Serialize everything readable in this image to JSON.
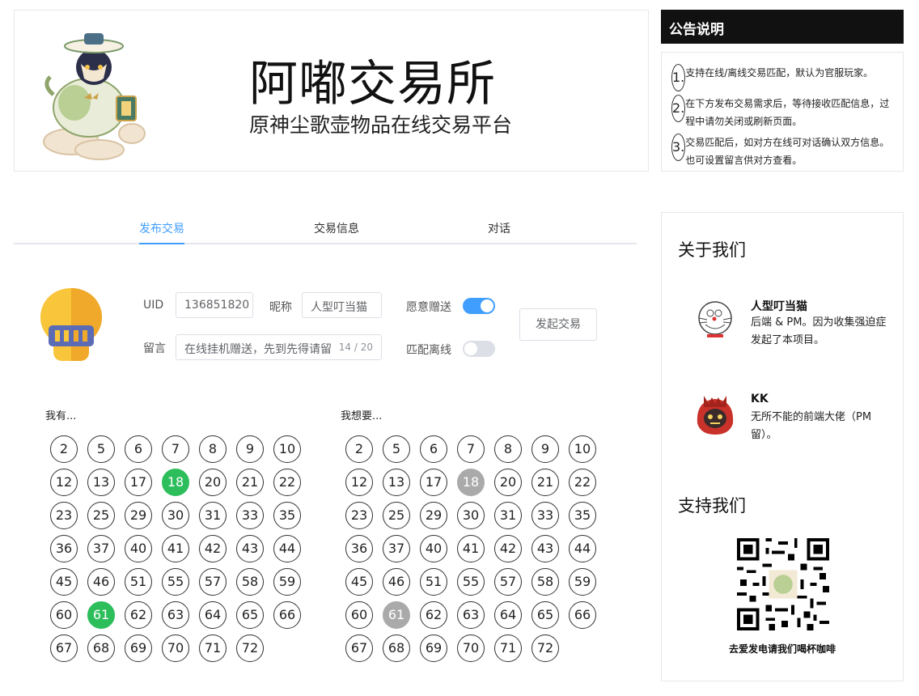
{
  "header": {
    "title": "阿嘟交易所",
    "subtitle": "原神尘歌壶物品在线交易平台"
  },
  "notice": {
    "title": "公告说明",
    "items": [
      {
        "num": "1.",
        "text": "支持在线/离线交易匹配，默认为官服玩家。"
      },
      {
        "num": "2.",
        "text": "在下方发布交易需求后，等待接收匹配信息，过程中请勿关闭或刷新页面。"
      },
      {
        "num": "3.",
        "text": "交易匹配后，如对方在线可对话确认双方信息。也可设置留言供对方查看。"
      }
    ]
  },
  "tabs": [
    {
      "label": "发布交易",
      "active": true
    },
    {
      "label": "交易信息",
      "active": false
    },
    {
      "label": "对话",
      "active": false
    }
  ],
  "form": {
    "uid_label": "UID",
    "uid_value": "136851820",
    "nickname_label": "昵称",
    "nickname_value": "人型叮当猫",
    "message_label": "留言",
    "message_value": "在线挂机赠送，先到先得请留",
    "message_counter": "14 / 20",
    "gift_label": "愿意赠送",
    "gift_on": true,
    "offline_label": "匹配离线",
    "offline_on": false,
    "submit_label": "发起交易"
  },
  "have": {
    "title": "我有...",
    "numbers": [
      "2",
      "5",
      "6",
      "7",
      "8",
      "9",
      "10",
      "12",
      "13",
      "17",
      "18",
      "20",
      "21",
      "22",
      "23",
      "25",
      "29",
      "30",
      "31",
      "33",
      "35",
      "36",
      "37",
      "40",
      "41",
      "42",
      "43",
      "44",
      "45",
      "46",
      "51",
      "55",
      "57",
      "58",
      "59",
      "60",
      "61",
      "62",
      "63",
      "64",
      "65",
      "66",
      "67",
      "68",
      "69",
      "70",
      "71",
      "72"
    ],
    "selected": [
      "18",
      "61"
    ],
    "selected_color": "#2dbe5c"
  },
  "want": {
    "title": "我想要...",
    "numbers": [
      "2",
      "5",
      "6",
      "7",
      "8",
      "9",
      "10",
      "12",
      "13",
      "17",
      "18",
      "20",
      "21",
      "22",
      "23",
      "25",
      "29",
      "30",
      "31",
      "33",
      "35",
      "36",
      "37",
      "40",
      "41",
      "42",
      "43",
      "44",
      "45",
      "46",
      "51",
      "55",
      "57",
      "58",
      "59",
      "60",
      "61",
      "62",
      "63",
      "64",
      "65",
      "66",
      "67",
      "68",
      "69",
      "70",
      "71",
      "72"
    ],
    "disabled": [
      "18",
      "61"
    ],
    "disabled_color": "#aaaaaa"
  },
  "about": {
    "title": "关于我们",
    "members": [
      {
        "name": "人型叮当猫",
        "desc": "后端 & PM。因为收集强迫症发起了本项目。",
        "avatar_icon": "doraemon-sketch-icon"
      },
      {
        "name": "KK",
        "desc": "无所不能的前端大佬（PM 留）。",
        "avatar_icon": "hilichurl-icon"
      }
    ]
  },
  "support": {
    "title": "支持我们",
    "caption": "去爱发电请我们喝杯咖啡"
  },
  "colors": {
    "accent": "#409eff",
    "notice_bg": "#111111"
  }
}
